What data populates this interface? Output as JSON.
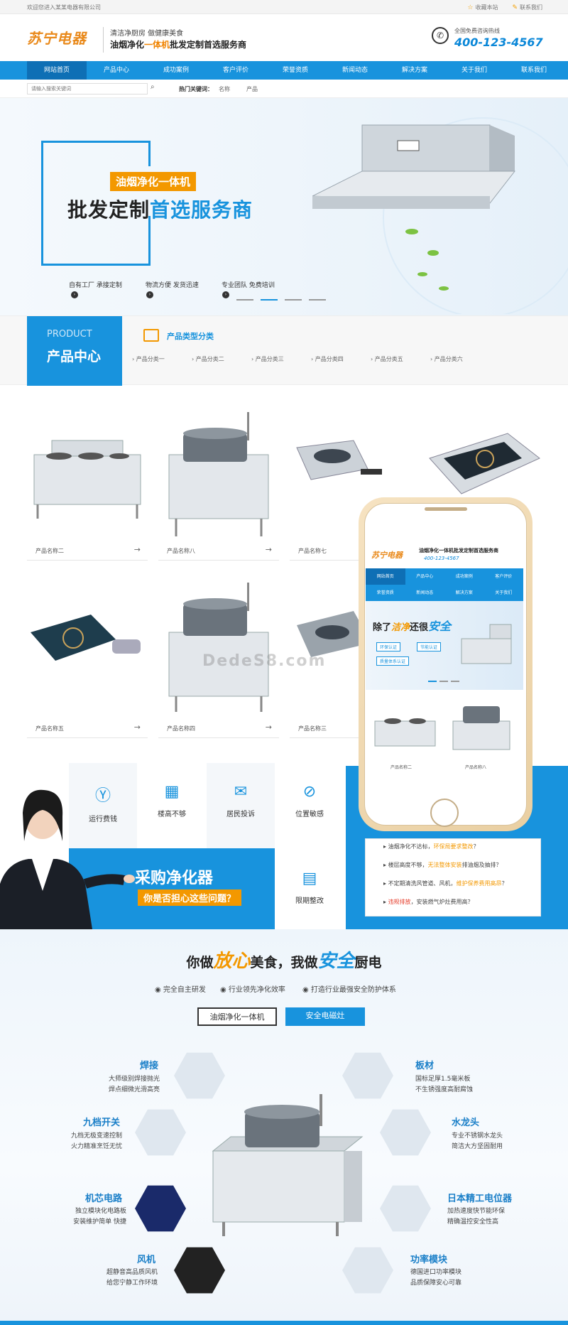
{
  "topbar": {
    "welcome": "欢迎您进入某某电器有限公司",
    "favorite": "收藏本站",
    "contact": "联系我们"
  },
  "header": {
    "logo": "苏宁电器",
    "tagline1": "清洁净厨房 做健康美食",
    "tagline2_a": "油烟净化",
    "tagline2_b": "一体机",
    "tagline2_c": "批发定制首选服务商",
    "hotline_label": "全国免费咨询热线",
    "hotline": "400-123-4567"
  },
  "nav": [
    "网站首页",
    "产品中心",
    "成功案例",
    "客户评价",
    "荣誉资质",
    "新闻动态",
    "解决方案",
    "关于我们",
    "联系我们"
  ],
  "search": {
    "placeholder": "请输入搜索关键词",
    "hot_label": "热门关键词：",
    "keywords": [
      "名称",
      "产品"
    ]
  },
  "banner": {
    "badge": "油烟净化一体机",
    "title_a": "批发定制",
    "title_b": "首选服务商",
    "features": [
      "自有工厂 承接定制",
      "物流方便 发货迅速",
      "专业团队 免费培训"
    ]
  },
  "products": {
    "en": "PRODUCT",
    "cn": "产品中心",
    "cat_title": "产品类型分类",
    "categories": [
      "产品分类一",
      "产品分类二",
      "产品分类三",
      "产品分类四",
      "产品分类五",
      "产品分类六"
    ],
    "items": [
      "产品名称二",
      "产品名称八",
      "产品名称七",
      "产品名称五",
      "产品名称四",
      "产品名称三"
    ]
  },
  "phone": {
    "logo": "苏宁电器",
    "slogan": "油烟净化一体机批发定制首选服务商",
    "hotline": "400-123-4567",
    "nav": [
      "网站首页",
      "产品中心",
      "成功案例",
      "客户评价",
      "荣誉资质",
      "新闻动态",
      "解决方案",
      "关于我们"
    ],
    "banner_a": "除了",
    "banner_b": "洁净",
    "banner_c": "还很",
    "banner_d": "安全",
    "badges": [
      "环保认证",
      "节能认证",
      "质量体系认证"
    ],
    "items": [
      "产品名称二",
      "产品名称八"
    ]
  },
  "why": {
    "items": [
      "运行费钱",
      "楼高不够",
      "居民投诉",
      "位置敏感",
      "限期整改"
    ],
    "big": "采购净化器",
    "question": "你是否担心这些问题？",
    "questions": [
      {
        "a": "油烟净化不达标，",
        "b": "环保局要求整改",
        "c": "？"
      },
      {
        "a": "楼层高度不够，",
        "b": "无法整体安装",
        "c": "排油烟及抽排？"
      },
      {
        "a": "不定期清洗风管道、风机，",
        "b": "维护保养费用高昂",
        "c": "？"
      },
      {
        "a": "",
        "b": "违规排放",
        "c": "，安装燃气炉灶费用高？"
      }
    ]
  },
  "features": {
    "t1": "你做",
    "t2": "放心",
    "t3": "美食，我做",
    "t4": "安全",
    "t5": "厨电",
    "subs": [
      "完全自主研发",
      "行业领先净化效率",
      "打造行业最强安全防护体系"
    ],
    "tabs": [
      "油烟净化一体机",
      "安全电磁灶"
    ],
    "left": [
      {
        "t": "焊接",
        "d1": "大师级别焊接抛光",
        "d2": "焊点细微光滑高亮"
      },
      {
        "t": "九档开关",
        "d1": "九档无极变速控制",
        "d2": "火力精准烹饪无忧"
      },
      {
        "t": "机芯电路",
        "d1": "独立模块化电路板",
        "d2": "安装维护简单 快捷"
      },
      {
        "t": "风机",
        "d1": "超静音高品质风机",
        "d2": "给您宁静工作环境"
      }
    ],
    "right": [
      {
        "t": "板材",
        "d1": "国标足厚1.5毫米板",
        "d2": "不生锈强度高耐腐蚀"
      },
      {
        "t": "水龙头",
        "d1": "专业不锈钢水龙头",
        "d2": "简洁大方坚固耐用"
      },
      {
        "t": "日本精工电位器",
        "d1": "加热速度快节能环保",
        "d2": "精确温控安全性高"
      },
      {
        "t": "功率模块",
        "d1": "德国进口功率模块",
        "d2": "品质保障安心可靠"
      }
    ]
  },
  "watermark": "DedeS8.com"
}
